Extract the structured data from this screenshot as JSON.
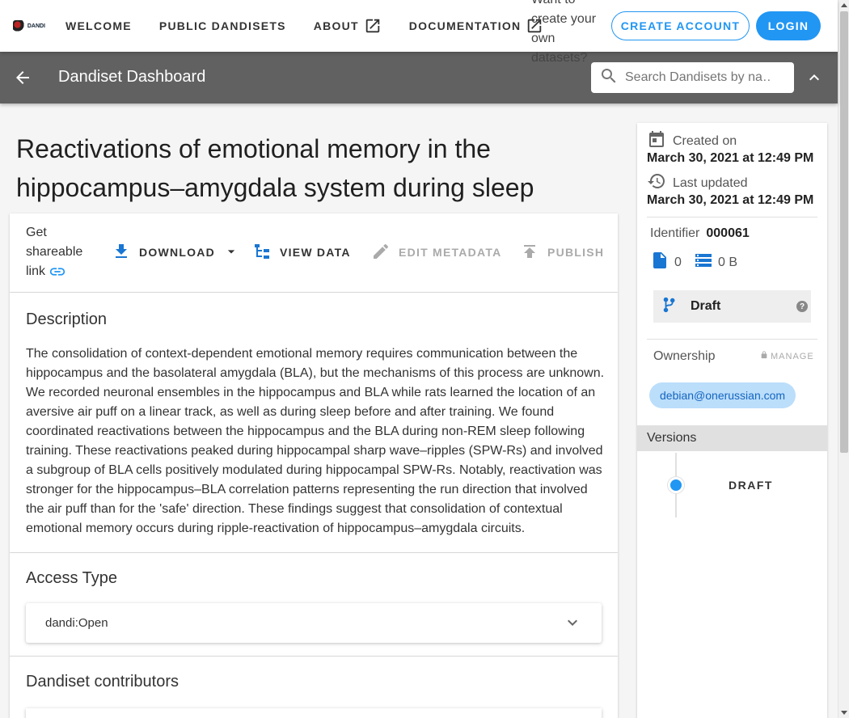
{
  "header": {
    "logo_text": "DANDI",
    "nav": [
      {
        "label": "Welcome",
        "external": false
      },
      {
        "label": "Public Dandisets",
        "external": false
      },
      {
        "label": "About",
        "external": true
      },
      {
        "label": "Documentation",
        "external": true
      }
    ],
    "promo": "Want to create your own datasets?",
    "create_account": "CREATE ACCOUNT",
    "login": "LOGIN",
    "accent_color": "#2196f3"
  },
  "subbar": {
    "title": "Dandiset Dashboard",
    "search_placeholder": "Search Dandisets by na…"
  },
  "dandiset": {
    "title": "Reactivations of emotional memory in the hippocampus–amygdala system during sleep",
    "toolbar": {
      "share": "Get shareable link",
      "download": "DOWNLOAD",
      "view_data": "VIEW DATA",
      "edit_metadata": "EDIT METADATA",
      "publish": "PUBLISH"
    },
    "description_heading": "Description",
    "description": "The consolidation of context-dependent emotional memory requires communication between the hippocampus and the basolateral amygdala (BLA), but the mechanisms of this process are unknown. We recorded neuronal ensembles in the hippocampus and BLA while rats learned the location of an aversive air puff on a linear track, as well as during sleep before and after training. We found coordinated reactivations between the hippocampus and the BLA during non-REM sleep following training. These reactivations peaked during hippocampal sharp wave–ripples (SPW-Rs) and involved a subgroup of BLA cells positively modulated during hippocampal SPW-Rs. Notably, reactivation was stronger for the hippocampus–BLA correlation patterns representing the run direction that involved the air puff than for the 'safe' direction. These findings suggest that consolidation of contextual emotional memory occurs during ripple-reactivation of hippocampus–amygdala circuits.",
    "access_heading": "Access Type",
    "access_value": "dandi:Open",
    "contributors_heading": "Dandiset contributors"
  },
  "side": {
    "created_label": "Created on",
    "created_date": "March 30, 2021 at 12:49 PM",
    "updated_label": "Last updated",
    "updated_date": "March 30, 2021 at 12:49 PM",
    "identifier_label": "Identifier",
    "identifier": "000061",
    "files": "0",
    "size": "0 B",
    "status": "Draft",
    "help": "?",
    "ownership_label": "Ownership",
    "manage": "MANAGE",
    "owner": "debian@onerussian.com",
    "versions_label": "Versions",
    "version": "DRAFT"
  }
}
